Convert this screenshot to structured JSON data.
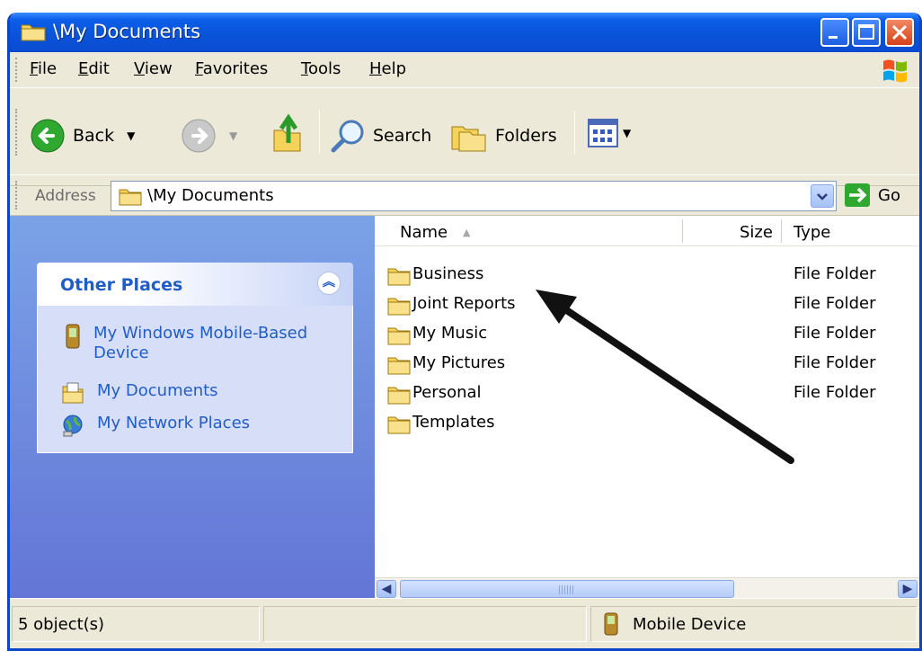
{
  "window": {
    "title": "\\My Documents",
    "buttons": {
      "minimize": "minimize",
      "maximize": "maximize",
      "close": "close"
    }
  },
  "menu": {
    "items": [
      "File",
      "Edit",
      "View",
      "Favorites",
      "Tools",
      "Help"
    ]
  },
  "toolbar": {
    "back_label": "Back",
    "search_label": "Search",
    "folders_label": "Folders"
  },
  "address": {
    "label": "Address",
    "value": "\\My Documents",
    "go_label": "Go"
  },
  "task_pane": {
    "panel_title": "Other Places",
    "places": [
      {
        "label": "My Windows Mobile-Based Device",
        "icon": "mobile-device-icon"
      },
      {
        "label": "My Documents",
        "icon": "my-documents-icon"
      },
      {
        "label": "My Network Places",
        "icon": "network-places-icon"
      }
    ]
  },
  "file_list": {
    "columns": {
      "name": "Name",
      "size": "Size",
      "type": "Type"
    },
    "rows": [
      {
        "name": "Business",
        "type": "File Folder"
      },
      {
        "name": "Joint Reports",
        "type": "File Folder"
      },
      {
        "name": "My Music",
        "type": "File Folder"
      },
      {
        "name": "My Pictures",
        "type": "File Folder"
      },
      {
        "name": "Personal",
        "type": "File Folder"
      },
      {
        "name": "Templates",
        "type": ""
      }
    ]
  },
  "status_bar": {
    "object_count": "5 object(s)",
    "location": "Mobile Device"
  },
  "colors": {
    "titlebar": "#0a53d8",
    "link": "#215dc6",
    "taskpane_top": "#7ba2e7",
    "taskpane_bottom": "#6375d6"
  }
}
